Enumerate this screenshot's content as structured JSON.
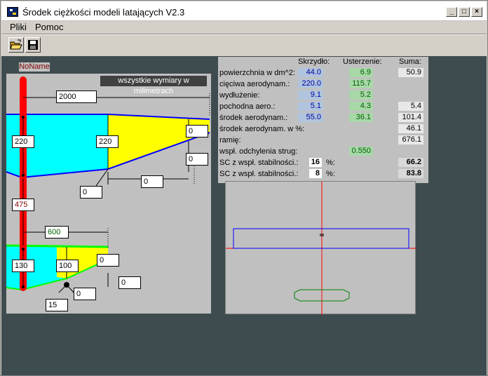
{
  "window": {
    "title": "Środek ciężkości modeli latających V2.3",
    "minimize": "_",
    "maximize": "□",
    "close": "×"
  },
  "menu": {
    "items": [
      "Pliki",
      "Pomoc"
    ]
  },
  "project": {
    "name": "NoName"
  },
  "drawing": {
    "units_note": "wszystkie wymiary w milimetrach",
    "wing": {
      "span": "2000",
      "root_chord": "220",
      "mid_chord": "220",
      "tip_chord_a": "0",
      "tip_offset_a": "0",
      "sweep_a": "0",
      "sweep_b": "0"
    },
    "distance": "475",
    "tail": {
      "span": "600",
      "root_chord": "130",
      "mid_chord": "100",
      "tip_chord": "0",
      "offset_a": "0",
      "offset_b": "0",
      "offset_c": "15"
    }
  },
  "results": {
    "headers": {
      "wing": "Skrzydło:",
      "tail": "Usterzenie:",
      "sum": "Suma:"
    },
    "rows": [
      {
        "label": "powierzchnia w dm^2:",
        "wing": "44.0",
        "tail": "6.9",
        "sum": "50.9"
      },
      {
        "label": "cięciwa aerodynam.:",
        "wing": "220.0",
        "tail": "115.7",
        "sum": ""
      },
      {
        "label": "wydłużenie:",
        "wing": "9.1",
        "tail": "5.2",
        "sum": ""
      },
      {
        "label": "pochodna aero.:",
        "wing": "5.1",
        "tail": "4.3",
        "sum": "5.4"
      },
      {
        "label": "środek aerodynam.:",
        "wing": "55.0",
        "tail": "36.1",
        "sum": "101.4"
      },
      {
        "label": "środek aerodynam. w %:",
        "wing": "",
        "tail": "",
        "sum": "46.1"
      },
      {
        "label": "ramię:",
        "wing": "",
        "tail": "",
        "sum": "676.1"
      },
      {
        "label": "wspł. odchylenia strug:",
        "wing": "",
        "tail": "0.550",
        "sum": ""
      }
    ],
    "sc1": {
      "label": "SC z wspł. stabilności.:",
      "percent_value": "16",
      "percent_sign": "%:",
      "result": "66.2"
    },
    "sc2": {
      "label": "SC z wspł. stabilności.:",
      "percent_value": "8",
      "percent_sign": "%:",
      "result": "83.8"
    }
  },
  "colors": {
    "fuselage": "#ff0000",
    "wing_fill_front": "#00ffff",
    "wing_fill_rear": "#ffff00",
    "wing_outline": "#0000ff",
    "tail_outline": "#00ff00",
    "background": "#3f4c4f"
  }
}
